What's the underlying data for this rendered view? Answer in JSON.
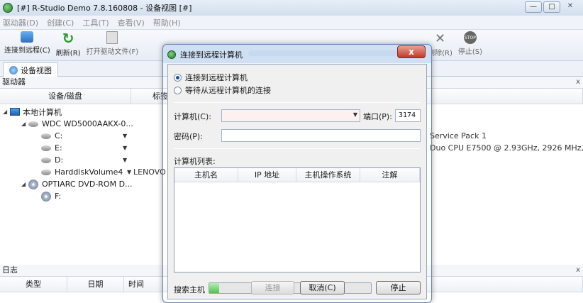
{
  "window": {
    "title": "[#] R-Studio Demo 7.8.160808 - 设备视图 [#]"
  },
  "menu": [
    "驱动器(D)",
    "创建(C)",
    "工具(T)",
    "查看(V)",
    "帮助(H)"
  ],
  "toolbar": {
    "connect": "连接到远程(C)",
    "refresh": "刷新(R)",
    "open_file": "打开驱动文件(F)",
    "delete": "删除(R)",
    "stop": "停止(S)",
    "stop_icon_text": "STOP"
  },
  "tab": {
    "label": "设备视图"
  },
  "drives_panel": {
    "title": "驱动器",
    "columns": [
      "设备/磁盘",
      "标签"
    ],
    "tree": {
      "local": "本地计算机",
      "disk1": "WDC WD5000AAKX-0...",
      "c": "C:",
      "e": "E:",
      "d": "D:",
      "hv": "HarddiskVolume4",
      "cd": "OPTIARC DVD-ROM D...",
      "f": "F:"
    },
    "hv_label": "LENOVO",
    "right_info_1": "Service Pack 1",
    "right_info_2": "Duo CPU    E7500  @ 2.93GHz, 2926 MHz,"
  },
  "log_panel": {
    "title": "日志",
    "columns": [
      "类型",
      "日期",
      "时间"
    ]
  },
  "dialog": {
    "title": "连接到远程计算机",
    "option_connect": "连接到远程计算机",
    "option_wait": "等待从远程计算机的连接",
    "computer_label": "计算机(C):",
    "computer_value": "",
    "port_label": "端口(P):",
    "port_value": "3174",
    "password_label": "密码(P):",
    "list_label": "计算机列表:",
    "list_columns": [
      "主机名",
      "IP 地址",
      "主机操作系统",
      "注解"
    ],
    "search_label": "搜索主机",
    "search_progress": 0.06,
    "stop_button": "停止",
    "connect_button": "连接",
    "cancel_button": "取消(C)"
  }
}
